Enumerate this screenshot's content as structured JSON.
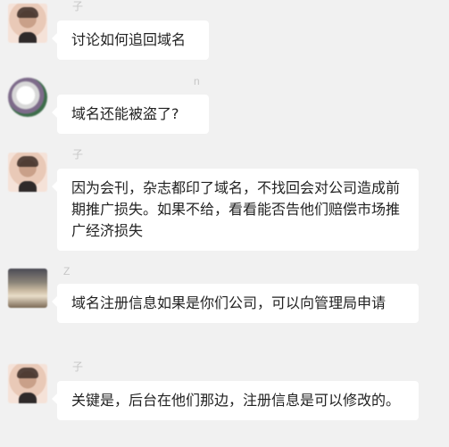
{
  "messages": [
    {
      "sender": "子",
      "avatar": "person-avatar",
      "text": "讨论如何追回域名"
    },
    {
      "sender": "n",
      "avatar": "cat-avatar",
      "text": "域名还能被盗了?"
    },
    {
      "sender": "子",
      "avatar": "person-avatar",
      "text": "因为会刊，杂志都印了域名，不找回会对公司造成前期推广损失。如果不给，看看能否告他们赔偿市场推广经济损失"
    },
    {
      "sender": "Z",
      "avatar": "scene-avatar",
      "text": "域名注册信息如果是你们公司，可以向管理局申请"
    },
    {
      "sender": "子",
      "avatar": "person-avatar",
      "text": "关键是，后台在他们那边，注册信息是可以修改的。"
    }
  ],
  "colors": {
    "background": "#f1f1f1",
    "bubble": "#ffffff",
    "text": "#222222",
    "name": "#c7c7c7"
  }
}
